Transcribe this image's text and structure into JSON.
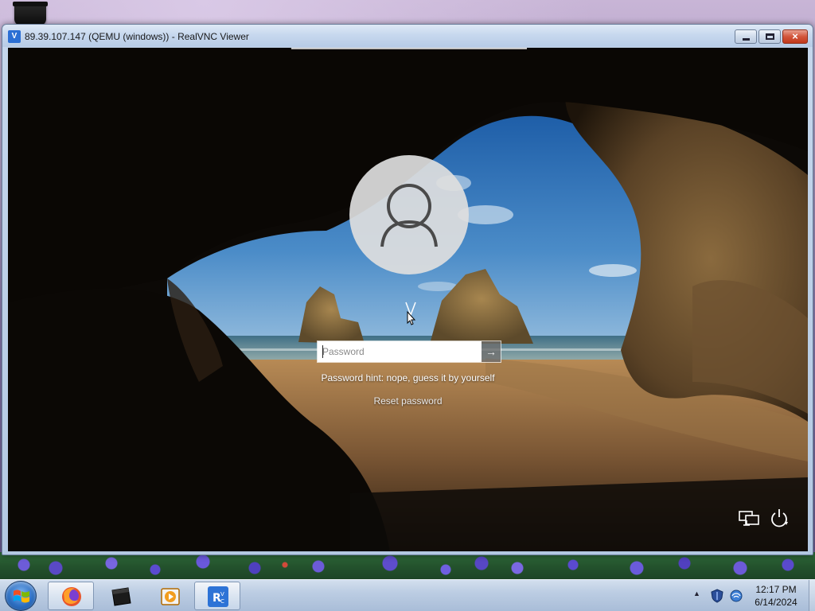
{
  "window": {
    "title": "89.39.107.147 (QEMU (windows)) - RealVNC Viewer",
    "app_icon": "realvnc-icon",
    "buttons": {
      "minimize": "minimize-icon",
      "maximize": "maximize-icon",
      "close": "×"
    }
  },
  "login": {
    "avatar_icon": "user-avatar-icon",
    "password_placeholder": "Password",
    "submit_glyph": "→",
    "hint": "Password hint: nope, guess it by yourself",
    "reset_link": "Reset password",
    "network_icon": "network-icon",
    "power_icon": "power-icon"
  },
  "taskbar": {
    "start": "windows-start-icon",
    "apps": [
      {
        "name": "firefox",
        "icon": "firefox-icon",
        "active": true
      },
      {
        "name": "terminal",
        "icon": "terminal-icon",
        "active": false
      },
      {
        "name": "media-player",
        "icon": "media-player-icon",
        "active": false
      },
      {
        "name": "realvnc-viewer",
        "icon": "realvnc-icon",
        "active": true
      }
    ],
    "tray": {
      "overflow": "▲",
      "icons": [
        "security-shield-icon",
        "network-status-icon"
      ],
      "time": "12:17 PM",
      "date": "6/14/2024"
    }
  },
  "colors": {
    "title_bar": "#c7d8ee",
    "close_button": "#c2391c",
    "taskbar": "#bccde3",
    "avatar_bg": "#dedede"
  }
}
